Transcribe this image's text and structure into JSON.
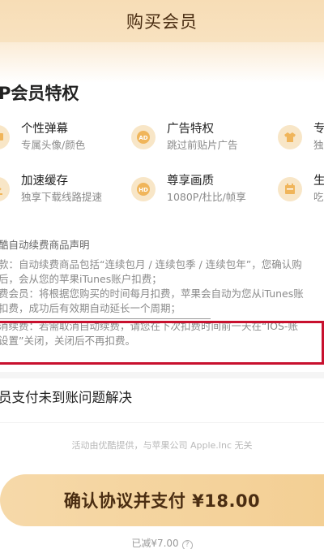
{
  "header": {
    "title": "购买会员"
  },
  "privileges": {
    "title": "P会员特权",
    "items": [
      {
        "name": "个性弹幕",
        "desc": "专属头像/颜色",
        "icon": "chat-bubble-icon"
      },
      {
        "name": "广告特权",
        "desc": "跳过前贴片广告",
        "icon": "ad-icon"
      },
      {
        "name": "专",
        "desc": "独",
        "icon": "tshirt-icon"
      },
      {
        "name": "加速缓存",
        "desc": "独享下载线路提速",
        "icon": "download-icon"
      },
      {
        "name": "尊享画质",
        "desc": "1080P/杜比/帧享",
        "icon": "hd-icon"
      },
      {
        "name": "生",
        "desc": "吃",
        "icon": "calendar-icon"
      }
    ]
  },
  "notice": {
    "title": "酷自动续费商品声明",
    "lines": [
      "款：自动续费商品包括“连续包月 / 连续包季 / 连续包年”，您确认购",
      "后，会从您的苹果iTunes账户扣费；",
      "费会员：将根据您购买的时间每月扣费，苹果会自动为您从iTunes账",
      "扣费，成功后有效期自动延长一个周期；",
      "消续费：若需取消自动续费，请您在下次扣费时间前一天在“IOS-账",
      "设置”关闭，关闭后不再扣费。"
    ]
  },
  "pay_issue": {
    "label": "员支付未到账问题解决"
  },
  "disclaimer": "活动由优酷提供，与苹果公司 Apple.Inc 无关",
  "pay_button": {
    "label": "确认协议并支付 ¥18.00"
  },
  "reduced": {
    "label": "已减¥7.00",
    "help": "?"
  }
}
